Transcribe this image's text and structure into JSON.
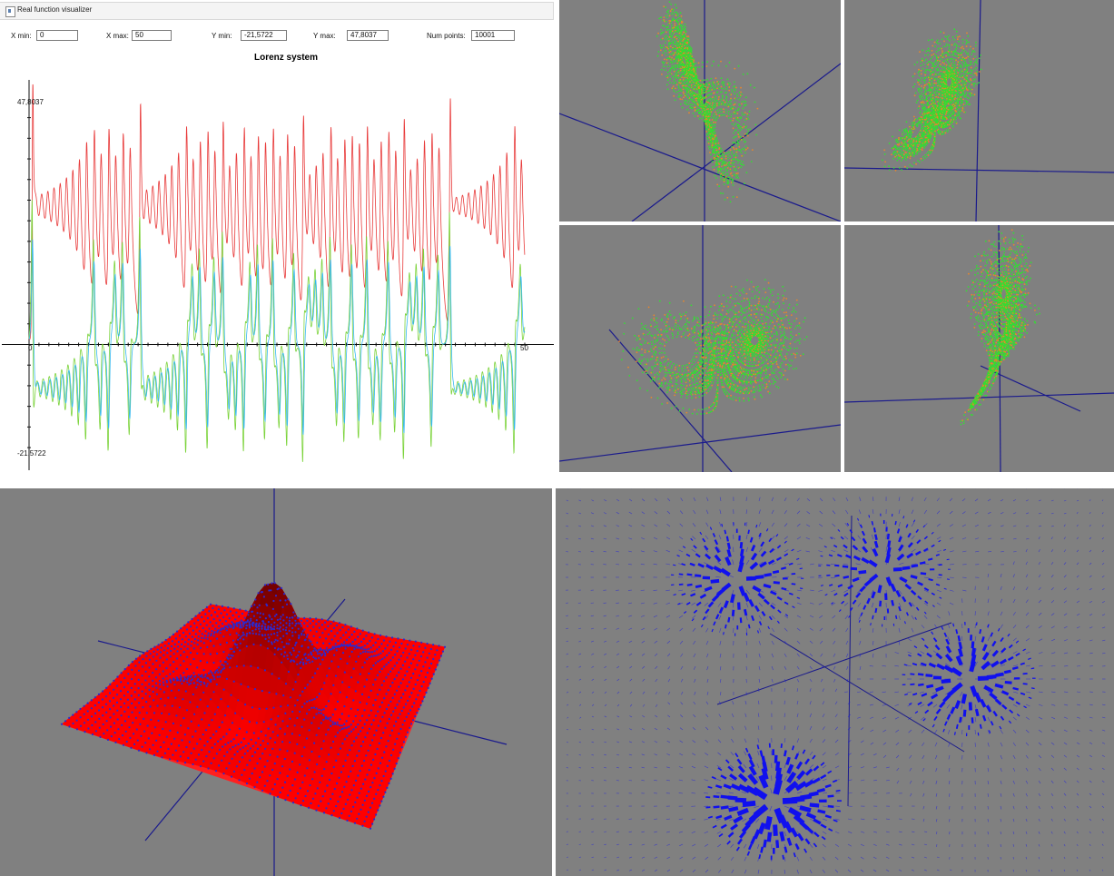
{
  "window": {
    "title": "Real function visualizer",
    "controls": [
      {
        "label": "X min:",
        "value": "0"
      },
      {
        "label": "X max:",
        "value": "50"
      },
      {
        "label": "Y min:",
        "value": "-21,5722"
      },
      {
        "label": "Y max:",
        "value": "47,8037"
      },
      {
        "label": "Num points:",
        "value": "10001"
      }
    ]
  },
  "chart_data": {
    "type": "line",
    "title": "Lorenz system",
    "xlim": [
      0,
      50
    ],
    "ylim": [
      -21.5722,
      47.8037
    ],
    "x_tick_labels": [
      "0",
      "50"
    ],
    "y_tick_labels": [
      "47,8037",
      "-21,5722"
    ],
    "series": [
      {
        "color": "#e83a3a",
        "values_description_range": [
          5,
          47.8037
        ]
      },
      {
        "color": "#7bd33a",
        "values_description_range": [
          -18,
          28
        ]
      },
      {
        "color": "#35b8f0",
        "values_description_range": [
          -21.5722,
          28
        ]
      }
    ],
    "grid": false
  },
  "views": {
    "background": "#808080",
    "axis_color": "#1a1a8c",
    "attractor_colors": [
      "#33dd33",
      "#e8862a"
    ],
    "surface_color": "#ff2020",
    "vector_color": "#1010ee"
  }
}
